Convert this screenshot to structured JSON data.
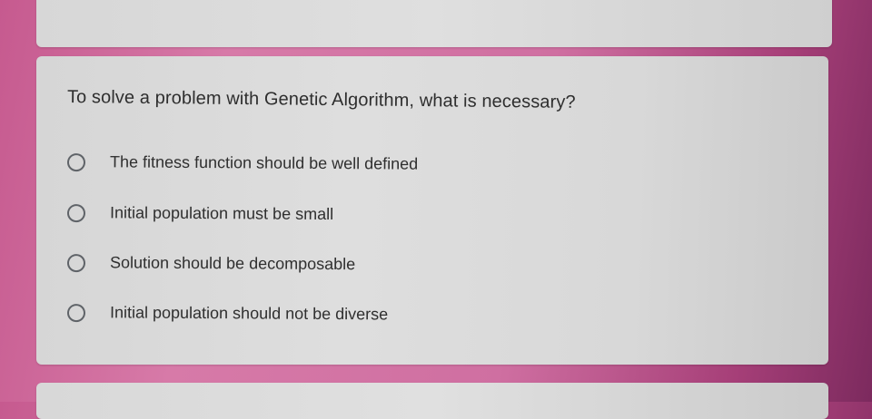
{
  "question": {
    "text": "To solve a problem with Genetic Algorithm, what is necessary?",
    "options": [
      {
        "label": "The fitness function should be well defined",
        "selected": false
      },
      {
        "label": "Initial population must be small",
        "selected": false
      },
      {
        "label": "Solution should be decomposable",
        "selected": false
      },
      {
        "label": "Initial population should not be diverse",
        "selected": false
      }
    ]
  },
  "colors": {
    "background_accent": "#cf6fa1",
    "card": "#dcdcdc",
    "text": "#2e2e2e",
    "radio_border": "#5f6368"
  }
}
